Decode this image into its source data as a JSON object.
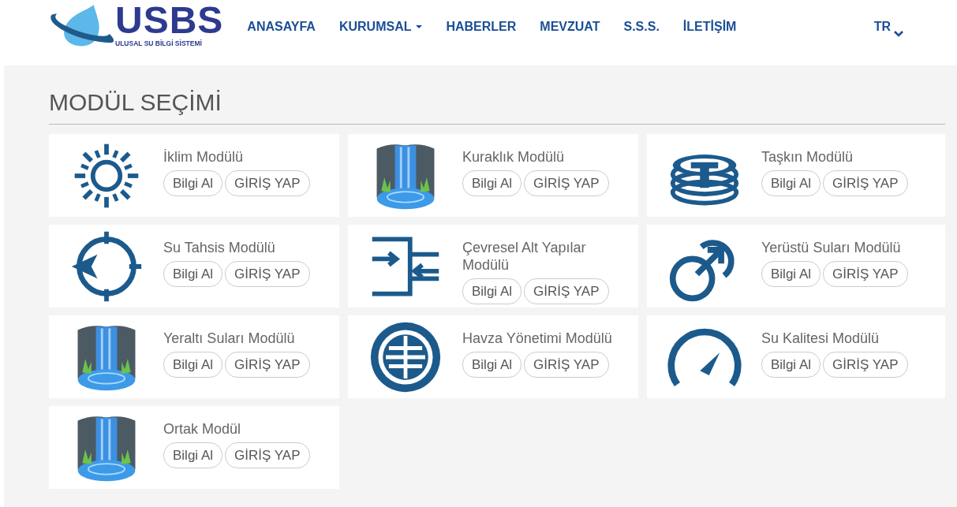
{
  "logo": {
    "name": "USBS",
    "subtitle": "ULUSAL SU BİLGİ SİSTEMİ"
  },
  "nav": [
    {
      "label": "ANASAYFA",
      "has_dropdown": false
    },
    {
      "label": "KURUMSAL",
      "has_dropdown": true
    },
    {
      "label": "HABERLER",
      "has_dropdown": false
    },
    {
      "label": "MEVZUAT",
      "has_dropdown": false
    },
    {
      "label": "S.S.S.",
      "has_dropdown": false
    },
    {
      "label": "İLETİŞİM",
      "has_dropdown": false
    }
  ],
  "language": "TR",
  "page_title": "MODÜL SEÇİMİ",
  "modules": [
    {
      "name": "İklim Modülü",
      "kind": "sun",
      "buttons": [
        "Bilgi Al",
        "GİRİŞ YAP"
      ]
    },
    {
      "name": "Kuraklık Modülü",
      "kind": "waterfall",
      "buttons": [
        "Bilgi Al",
        "GİRİŞ YAP"
      ]
    },
    {
      "name": "Taşkın Modülü",
      "kind": "coins",
      "buttons": [
        "Bilgi Al",
        "GİRİŞ YAP"
      ]
    },
    {
      "name": "Su Tahsis Modülü",
      "kind": "target",
      "buttons": [
        "Bilgi Al",
        "GİRİŞ YAP"
      ]
    },
    {
      "name": "Çevresel Alt Yapılar Modülü",
      "kind": "merge",
      "buttons": [
        "Bilgi Al",
        "GİRİŞ YAP"
      ]
    },
    {
      "name": "Yerüstü Suları Modülü",
      "kind": "link",
      "buttons": [
        "Bilgi Al",
        "GİRİŞ YAP"
      ]
    },
    {
      "name": "Yeraltı Suları Modülü",
      "kind": "waterfall",
      "buttons": [
        "Bilgi Al",
        "GİRİŞ YAP"
      ]
    },
    {
      "name": "Havza Yönetimi Modülü",
      "kind": "emblem",
      "buttons": [
        "Bilgi Al",
        "GİRİŞ YAP"
      ]
    },
    {
      "name": "Su Kalitesi Modülü",
      "kind": "gauge",
      "buttons": [
        "Bilgi Al",
        "GİRİŞ YAP"
      ]
    },
    {
      "name": "Ortak Modül",
      "kind": "waterfall",
      "buttons": [
        "Bilgi Al",
        "GİRİŞ YAP"
      ]
    }
  ]
}
